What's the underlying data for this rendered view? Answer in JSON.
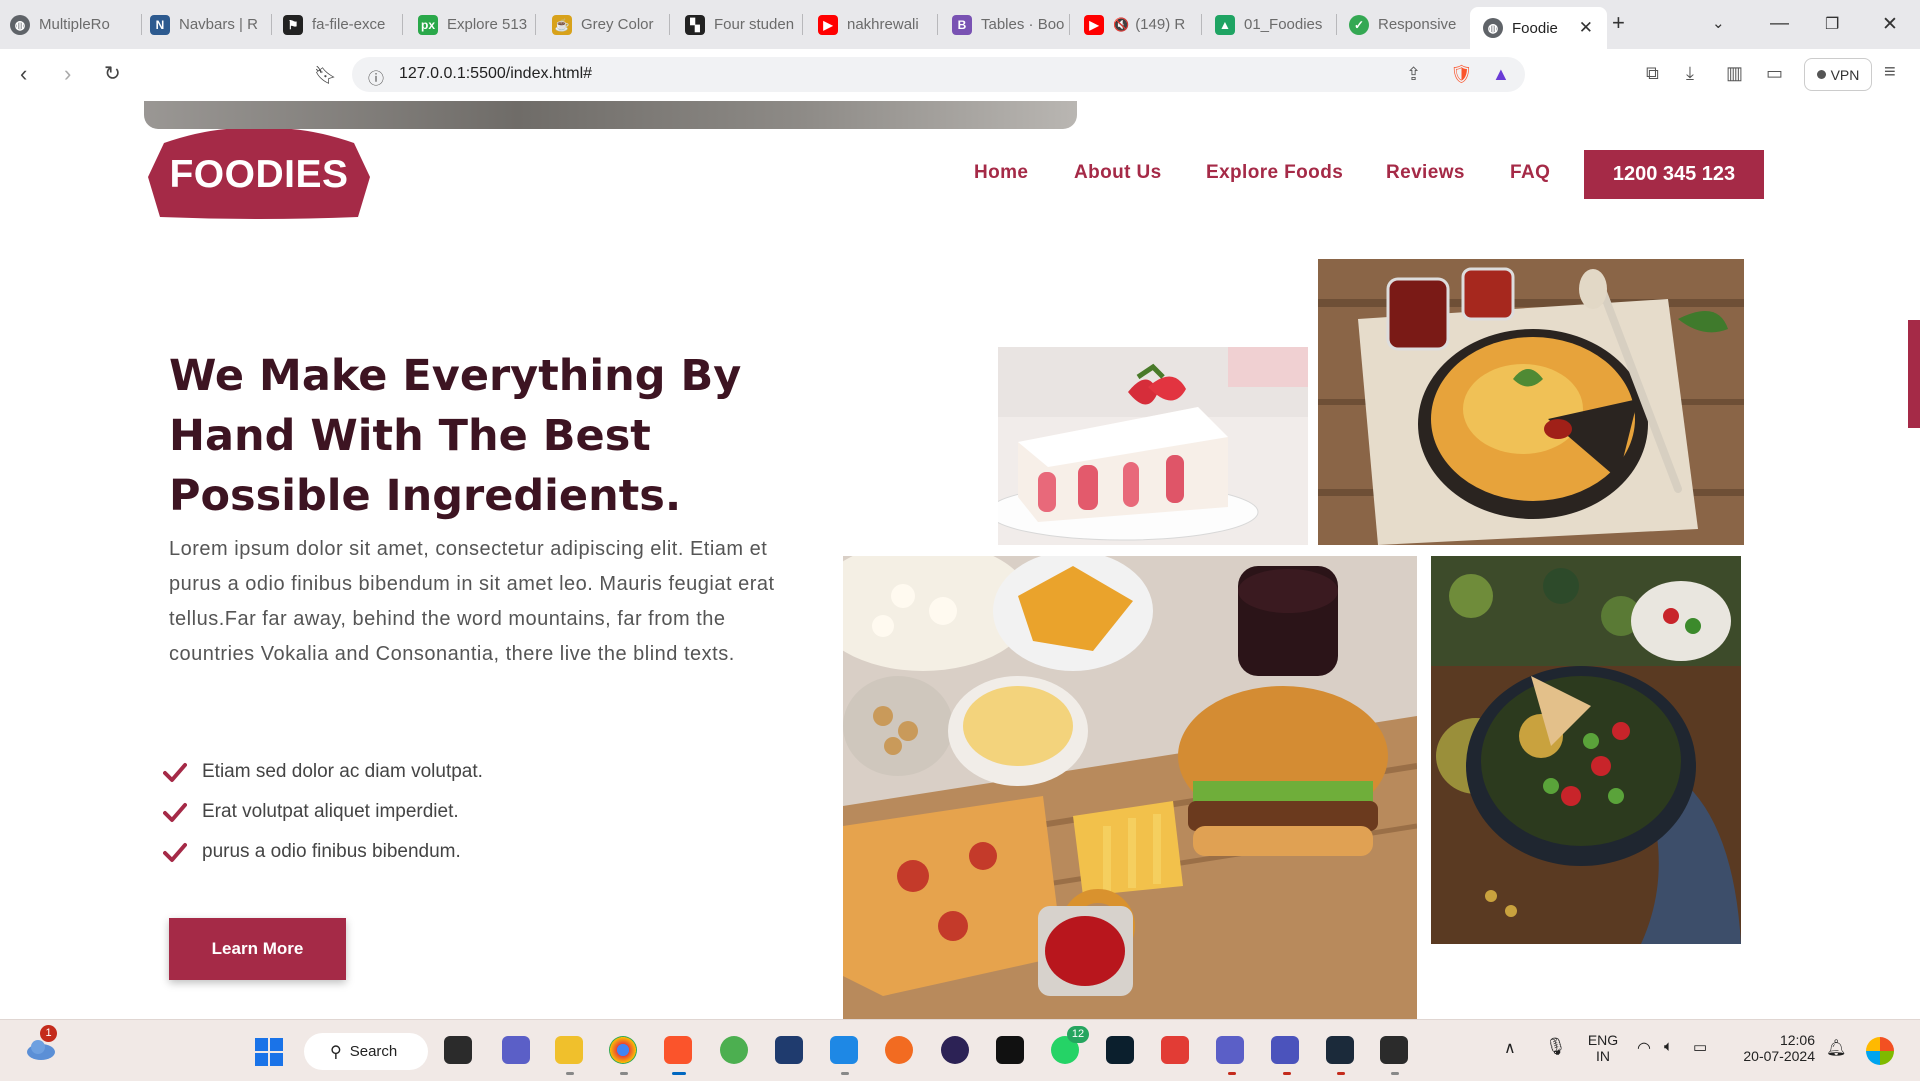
{
  "browser": {
    "tabs": [
      {
        "title": "MultipleRo",
        "icon": "globe-icon",
        "color": "#5f6368"
      },
      {
        "title": "Navbars | R",
        "icon": "navbars-app-icon",
        "color": "#2d5a8f"
      },
      {
        "title": "fa-file-exce",
        "icon": "flag-icon",
        "color": "#222222"
      },
      {
        "title": "Explore 513",
        "icon": "px-icon",
        "color": "#2aa84a"
      },
      {
        "title": "Grey Color",
        "icon": "cup-icon",
        "color": "#d8a21b"
      },
      {
        "title": "Four studen",
        "icon": "blocks-icon",
        "color": "#222222"
      },
      {
        "title": "nakhrewali",
        "icon": "youtube-icon",
        "color": "#ff0000"
      },
      {
        "title": "Tables · Boo",
        "icon": "bootstrap-icon",
        "color": "#7952b3"
      },
      {
        "title": "(149) R",
        "icon": "youtube-muted-icon",
        "color": "#ff0000"
      },
      {
        "title": "01_Foodies",
        "icon": "google-drive-icon",
        "color": "#1fa463"
      },
      {
        "title": "Responsive",
        "icon": "leaf-icon",
        "color": "#34a853"
      },
      {
        "title": "Foodie",
        "icon": "globe-icon",
        "color": "#5f6368"
      }
    ],
    "url": "127.0.0.1:5500/index.html#",
    "vpn_label": "VPN"
  },
  "site": {
    "logo_text": "FOODIES",
    "nav": [
      "Home",
      "About Us",
      "Explore Foods",
      "Reviews",
      "FAQ"
    ],
    "phone": "1200 345 123",
    "headline": "We Make Everything By Hand With The Best Possible Ingredients.",
    "paragraph": "Lorem ipsum dolor sit amet, consectetur adipiscing elit. Etiam et purus a odio finibus bibendum in sit amet leo. Mauris feugiat erat tellus.Far far away, behind the word mountains, far from the countries Vokalia and Consonantia, there live the blind texts.",
    "checklist": [
      "Etiam sed dolor ac diam volutpat.",
      "Erat volutpat aliquet imperdiet.",
      "purus a odio finibus bibendum."
    ],
    "cta": "Learn More",
    "brand_color": "#a52a47",
    "heading_color": "#3d1422"
  },
  "taskbar": {
    "search_label": "Search",
    "weather_badge": "1",
    "whatsapp_badge": "12",
    "language": "ENG",
    "region": "IN",
    "time": "12:06",
    "date": "20-07-2024"
  }
}
